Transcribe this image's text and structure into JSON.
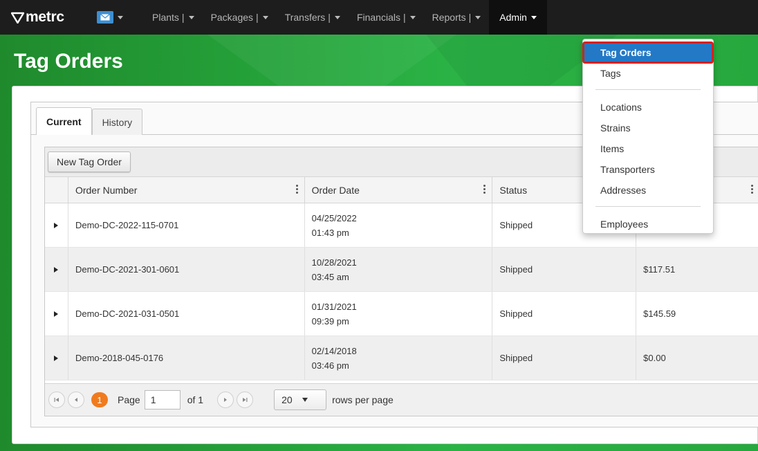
{
  "nav": {
    "brand": "metrc",
    "items": [
      {
        "label": "Plants"
      },
      {
        "label": "Packages"
      },
      {
        "label": "Transfers"
      },
      {
        "label": "Financials"
      },
      {
        "label": "Reports"
      }
    ],
    "active": "Admin",
    "separator": "|"
  },
  "page": {
    "title": "Tag Orders"
  },
  "tabs": [
    {
      "label": "Current",
      "active": true
    },
    {
      "label": "History",
      "active": false
    }
  ],
  "toolbar": {
    "new_label": "New Tag Order"
  },
  "columns": [
    "Order Number",
    "Order Date",
    "Status"
  ],
  "rows": [
    {
      "number": "Demo-DC-2022-115-0701",
      "date": "04/25/2022",
      "time": "01:43 pm",
      "status": "Shipped",
      "amount": ""
    },
    {
      "number": "Demo-DC-2021-301-0601",
      "date": "10/28/2021",
      "time": "03:45 am",
      "status": "Shipped",
      "amount": "$117.51"
    },
    {
      "number": "Demo-DC-2021-031-0501",
      "date": "01/31/2021",
      "time": "09:39 pm",
      "status": "Shipped",
      "amount": "$145.59"
    },
    {
      "number": "Demo-2018-045-0176",
      "date": "02/14/2018",
      "time": "03:46 pm",
      "status": "Shipped",
      "amount": "$0.00"
    }
  ],
  "pager": {
    "current_page": "1",
    "page_label": "Page",
    "page_value": "1",
    "of_label": "of 1",
    "rows_value": "20",
    "rows_label": "rows per page"
  },
  "admin_menu": {
    "items_group1": [
      "Tag Orders",
      "Tags"
    ],
    "items_group2": [
      "Locations",
      "Strains",
      "Items",
      "Transporters",
      "Addresses"
    ],
    "items_group3": [
      "Employees"
    ],
    "selected": "Tag Orders"
  },
  "colors": {
    "navbar": "#1d1d1d",
    "header_green": "#25a23a",
    "selected_menu": "#2379c6",
    "highlight_outline": "#d42121",
    "pager_current": "#f07b1f",
    "mail_button": "#3d8fd1"
  },
  "icons": [
    "metrc-logo-icon",
    "mail-icon",
    "caret-down-icon",
    "kebab-menu-icon",
    "expand-row-icon",
    "first-page-icon",
    "prev-page-icon",
    "next-page-icon",
    "last-page-icon"
  ]
}
